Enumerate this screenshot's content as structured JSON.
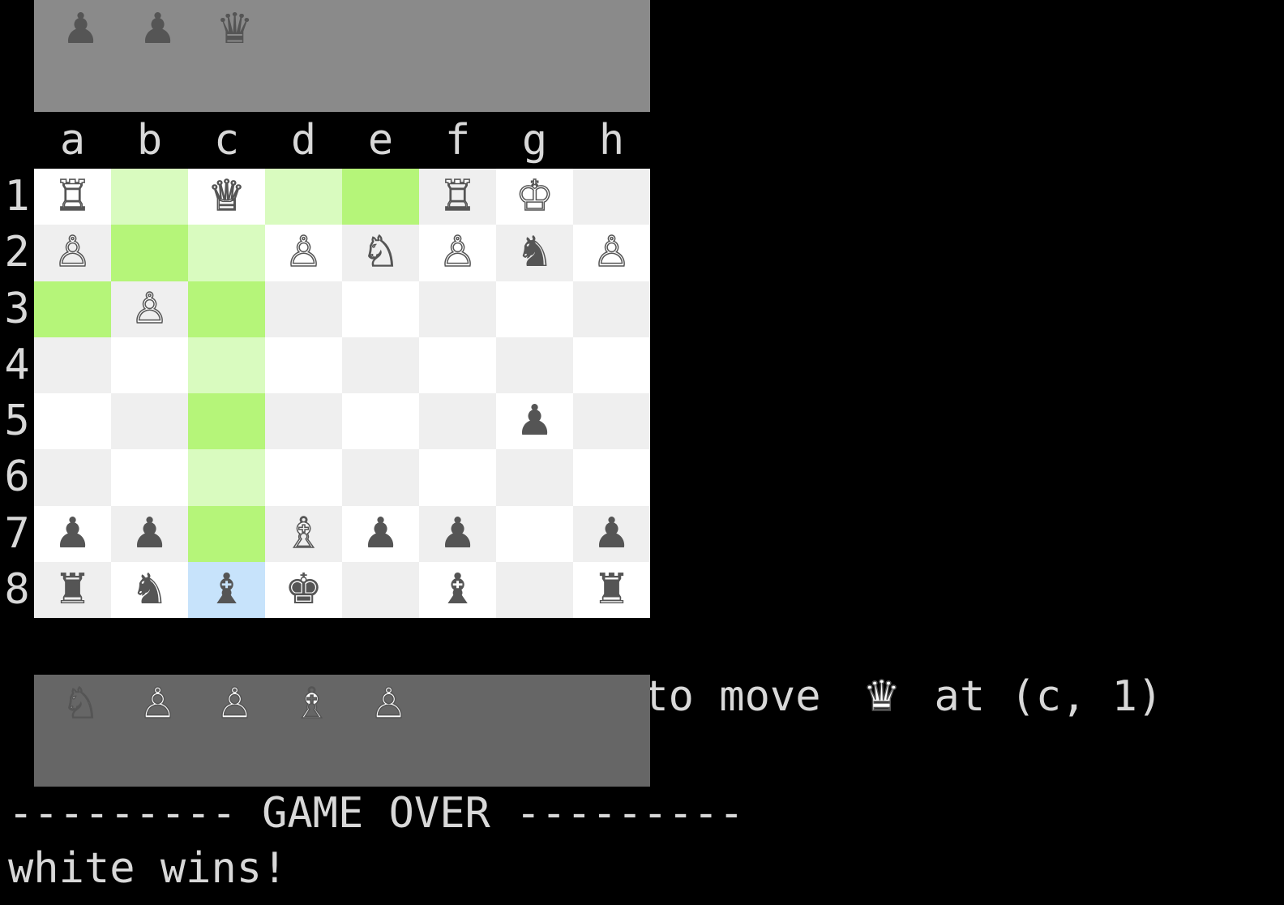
{
  "captured_top": [
    {
      "glyph": "♟",
      "color": "black",
      "icon": "black-pawn-icon"
    },
    {
      "glyph": "♟",
      "color": "black",
      "icon": "black-pawn-icon"
    },
    {
      "glyph": "♛",
      "color": "black",
      "icon": "black-queen-icon"
    }
  ],
  "captured_bottom": [
    {
      "glyph": "♘",
      "color": "white",
      "icon": "white-knight-icon"
    },
    {
      "glyph": "♙",
      "color": "white",
      "icon": "white-pawn-icon"
    },
    {
      "glyph": "♙",
      "color": "white",
      "icon": "white-pawn-icon"
    },
    {
      "glyph": "♗",
      "color": "white",
      "icon": "white-bishop-icon"
    },
    {
      "glyph": "♙",
      "color": "white",
      "icon": "white-pawn-icon"
    }
  ],
  "files": [
    "a",
    "b",
    "c",
    "d",
    "e",
    "f",
    "g",
    "h"
  ],
  "ranks": [
    "1",
    "2",
    "3",
    "4",
    "5",
    "6",
    "7",
    "8"
  ],
  "colors": {
    "light": "#ffffff",
    "dark": "#efefef",
    "move_light": "#d9fbbf",
    "move_strong": "#b5f579",
    "selected": "#c7e3fb",
    "tray_top": "#8a8a8a",
    "tray_bottom": "#666666"
  },
  "highlights": {
    "b1": "move_light",
    "d1": "move_light",
    "e1": "move_strong",
    "b2": "move_strong",
    "c2": "move_light",
    "a3": "move_strong",
    "c3": "move_strong",
    "c4": "move_light",
    "c5": "move_strong",
    "c6": "move_light",
    "c7": "move_strong",
    "c8": "selected"
  },
  "board": {
    "1": [
      "♖w",
      "",
      "♕w",
      "",
      "",
      "♖w",
      "♔w",
      ""
    ],
    "2": [
      "♙w",
      "",
      "",
      "♙w",
      "♘w",
      "♙w",
      "♞b",
      "♙w"
    ],
    "3": [
      "",
      "♙w",
      "",
      "",
      "",
      "",
      "",
      ""
    ],
    "4": [
      "",
      "",
      "",
      "",
      "",
      "",
      "",
      ""
    ],
    "5": [
      "",
      "",
      "",
      "",
      "",
      "",
      "♟b",
      ""
    ],
    "6": [
      "",
      "",
      "",
      "",
      "",
      "",
      "",
      ""
    ],
    "7": [
      "♟b",
      "♟b",
      "",
      "♗w",
      "♟b",
      "♟b",
      "",
      "♟b"
    ],
    "8": [
      "♜b",
      "♞b",
      "♝b",
      "♚b",
      "",
      "♝b",
      "",
      "♜b"
    ]
  },
  "piece_names": {
    "♔": "king",
    "♕": "queen",
    "♖": "rook",
    "♗": "bishop",
    "♘": "knight",
    "♙": "pawn",
    "♚": "king",
    "♛": "queen",
    "♜": "rook",
    "♝": "bishop",
    "♞": "knight",
    "♟": "pawn"
  },
  "status": {
    "prefix": "white is attempting to move",
    "piece_glyph": "♛",
    "suffix": "at (c, 1)"
  },
  "game_over": "--------- GAME OVER ---------",
  "winner": "white wins!"
}
